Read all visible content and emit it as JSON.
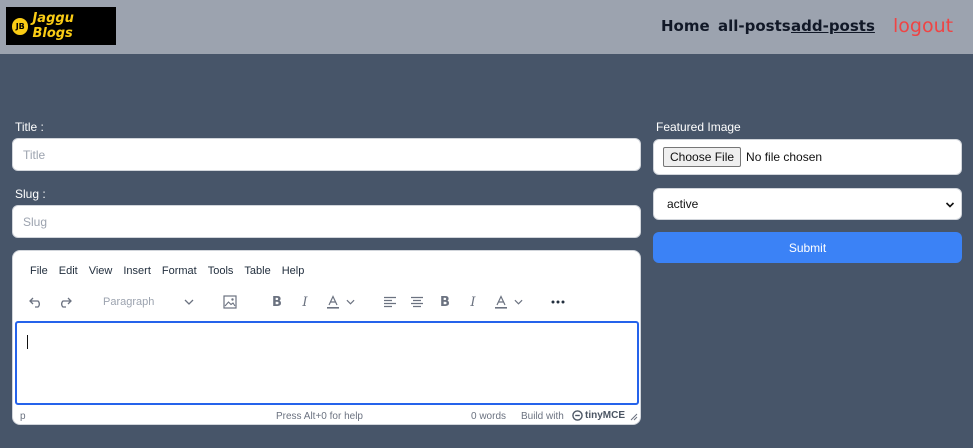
{
  "header": {
    "logo": {
      "badge": "JB",
      "text": "Jaggu Blogs"
    },
    "nav": [
      {
        "label": "Home",
        "active": false
      },
      {
        "label": "all-posts",
        "active": false
      },
      {
        "label": "add-posts",
        "active": true
      }
    ],
    "logout_label": "logout"
  },
  "form": {
    "title_label": "Title :",
    "title_placeholder": "Title",
    "slug_label": "Slug :",
    "slug_placeholder": "Slug"
  },
  "editor": {
    "menu": [
      "File",
      "Edit",
      "View",
      "Insert",
      "Format",
      "Tools",
      "Table",
      "Help"
    ],
    "block_format": "Paragraph",
    "status": {
      "path": "p",
      "help": "Press Alt+0 for help",
      "word_count": "0 words",
      "build_with": "Build with",
      "brand": "tinyMCE"
    }
  },
  "sidebar": {
    "image_label": "Featured Image",
    "choose_file_label": "Choose File",
    "file_status": "No file chosen",
    "status_select": {
      "selected": "active"
    },
    "submit_label": "Submit"
  },
  "colors": {
    "page_bg": "#475569",
    "header_bg": "#9ca3af",
    "logout": "#ef4444",
    "submit_bg": "#3b82f6",
    "logo_accent": "#facc15"
  },
  "icons": [
    "undo-icon",
    "redo-icon",
    "image-icon",
    "bold-icon",
    "italic-icon",
    "text-color-icon",
    "align-left-icon",
    "align-center-icon",
    "more-icon",
    "chevron-down-icon",
    "resize-handle-icon"
  ]
}
